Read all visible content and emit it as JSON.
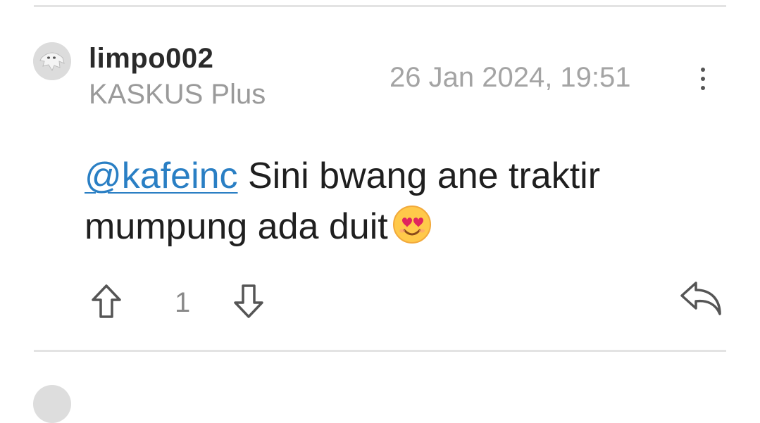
{
  "post": {
    "username": "limpo002",
    "rank": "KASKUS Plus",
    "timestamp": "26 Jan 2024, 19:51",
    "mention": "@kafeinc",
    "text_line1": " Sini bwang ane traktir",
    "text_line2": "mumpung ada duit",
    "emoji": "smiling-face-with-heart-eyes",
    "vote_count": "1"
  },
  "icons": {
    "more": "more-vertical-icon",
    "upvote": "arrow-up-icon",
    "downvote": "arrow-down-icon",
    "reply": "reply-icon",
    "avatar": "kaskus-ghost-avatar"
  },
  "colors": {
    "mention": "#2a7fc4",
    "muted_text": "#9a9a9a",
    "divider": "#e3e3e3",
    "icon": "#555555"
  }
}
